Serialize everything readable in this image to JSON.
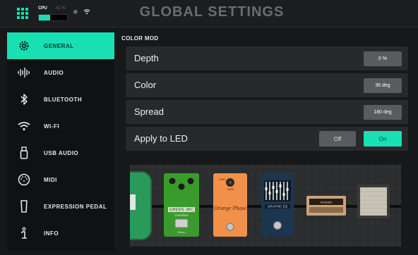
{
  "header": {
    "title": "GLOBAL SETTINGS",
    "cpu_label": "CPU",
    "cpu_percent_label": "41 %",
    "cpu_percent": 41
  },
  "sidebar": {
    "items": [
      {
        "label": "GENERAL",
        "icon": "gear-icon",
        "active": true
      },
      {
        "label": "AUDIO",
        "icon": "waveform-icon",
        "active": false
      },
      {
        "label": "BLUETOOTH",
        "icon": "bluetooth-icon",
        "active": false
      },
      {
        "label": "WI-FI",
        "icon": "wifi-icon",
        "active": false
      },
      {
        "label": "USB AUDIO",
        "icon": "usb-icon",
        "active": false
      },
      {
        "label": "MIDI",
        "icon": "midi-icon",
        "active": false
      },
      {
        "label": "EXPRESSION PEDAL",
        "icon": "expression-pedal-icon",
        "active": false
      },
      {
        "label": "INFO",
        "icon": "info-icon",
        "active": false
      }
    ]
  },
  "main": {
    "section_title": "COLOR MOD",
    "rows": {
      "depth": {
        "label": "Depth",
        "value": "0 %"
      },
      "color": {
        "label": "Color",
        "value": "36 deg"
      },
      "spread": {
        "label": "Spread",
        "value": "180 deg"
      },
      "apply_led": {
        "label": "Apply to LED",
        "off_label": "Off",
        "on_label": "On",
        "selected": "On"
      }
    }
  },
  "pedals": {
    "green_pedal": {
      "brand": "GREEN JRC",
      "subtitle": "Overdrive",
      "footer": "Elixon"
    },
    "orange_pedal": {
      "knob_left": "SYNC",
      "knob_right": "RATE",
      "script": "Orange Phase"
    },
    "eq_pedal": {
      "name": "GRAPHIC EQ"
    },
    "amp": {
      "label": "FENDER"
    }
  },
  "colors": {
    "accent": "#18e0b2",
    "panel": "#28292b",
    "value_button": "#5a5b5d"
  }
}
